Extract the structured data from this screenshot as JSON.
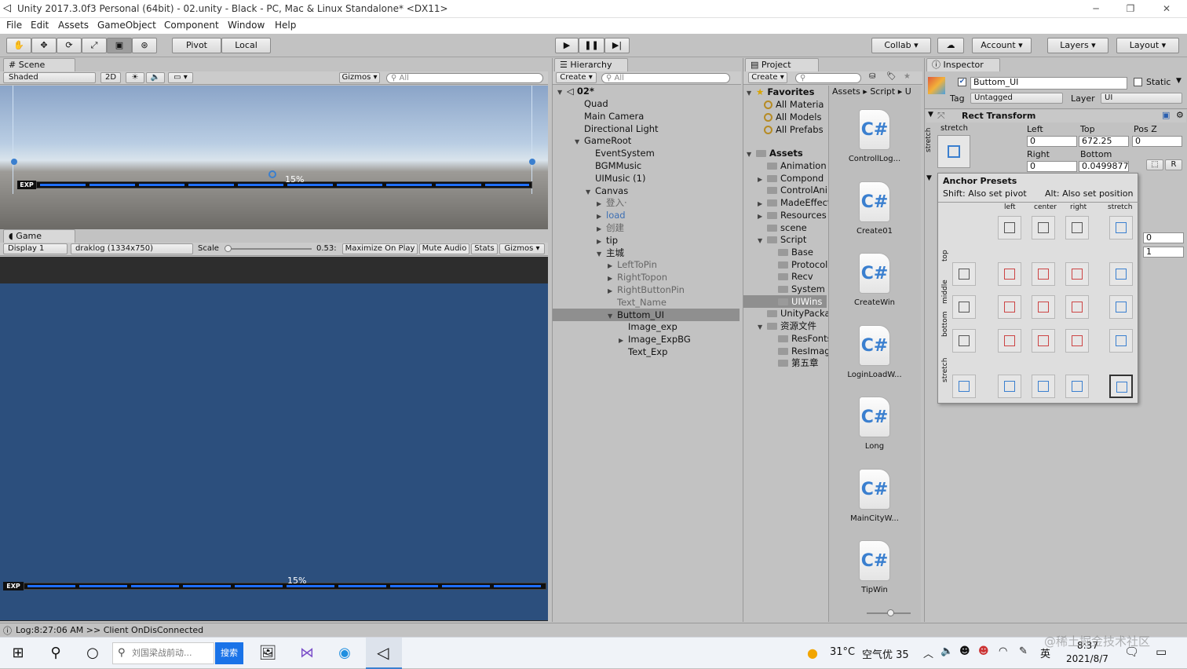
{
  "window": {
    "title": "Unity 2017.3.0f3 Personal (64bit) - 02.unity - Black - PC, Mac & Linux Standalone* <DX11>",
    "minimize": "─",
    "maximize": "❐",
    "close": "✕"
  },
  "menu": [
    "File",
    "Edit",
    "Assets",
    "GameObject",
    "Component",
    "Window",
    "Help"
  ],
  "toolbar": {
    "tools": [
      "hand-icon",
      "move-icon",
      "rotate-icon",
      "scale-icon",
      "rect-icon",
      "transform-icon"
    ],
    "pivot": "Pivot",
    "local": "Local",
    "collab": "Collab ▾",
    "account": "Account",
    "layers": "Layers",
    "layout": "Layout"
  },
  "scene": {
    "tab": "Scene",
    "shading": "Shaded",
    "mode2d": "2D",
    "gizmos": "Gizmos",
    "search_placeholder": "All",
    "exp_label": "EXP",
    "exp_percent": "15%"
  },
  "game": {
    "tab": "Game",
    "display": "Display 1",
    "resolution": "draklog (1334x750)",
    "scale_label": "Scale",
    "scale_value": "0.53:",
    "maximize": "Maximize On Play",
    "mute": "Mute Audio",
    "stats": "Stats",
    "gizmos": "Gizmos",
    "exp_label": "EXP",
    "exp_percent": "15%"
  },
  "hierarchy": {
    "tab": "Hierarchy",
    "create": "Create",
    "search_placeholder": "All",
    "scene_name": "02*",
    "items": [
      {
        "label": "Quad",
        "indent": 1,
        "arrow": ""
      },
      {
        "label": "Main Camera",
        "indent": 1,
        "arrow": ""
      },
      {
        "label": "Directional Light",
        "indent": 1,
        "arrow": ""
      },
      {
        "label": "GameRoot",
        "indent": 1,
        "arrow": "▼"
      },
      {
        "label": "EventSystem",
        "indent": 2,
        "arrow": ""
      },
      {
        "label": "BGMMusic",
        "indent": 2,
        "arrow": ""
      },
      {
        "label": "UIMusic (1)",
        "indent": 2,
        "arrow": ""
      },
      {
        "label": "Canvas",
        "indent": 2,
        "arrow": "▼"
      },
      {
        "label": "登入·",
        "indent": 3,
        "arrow": "▶",
        "dim": true
      },
      {
        "label": "load",
        "indent": 3,
        "arrow": "▶",
        "blue": true
      },
      {
        "label": "创建",
        "indent": 3,
        "arrow": "▶",
        "dim": true
      },
      {
        "label": "tip",
        "indent": 3,
        "arrow": "▶"
      },
      {
        "label": "主城",
        "indent": 3,
        "arrow": "▼"
      },
      {
        "label": "LeftToPin",
        "indent": 4,
        "arrow": "▶",
        "dim": true
      },
      {
        "label": "RightTopon",
        "indent": 4,
        "arrow": "▶",
        "dim": true
      },
      {
        "label": "RightButtonPin",
        "indent": 4,
        "arrow": "▶",
        "dim": true
      },
      {
        "label": "Text_Name",
        "indent": 4,
        "arrow": "",
        "dim": true
      },
      {
        "label": "Buttom_UI",
        "indent": 4,
        "arrow": "▼",
        "sel": true
      },
      {
        "label": "Image_exp",
        "indent": 5,
        "arrow": ""
      },
      {
        "label": "Image_ExpBG",
        "indent": 5,
        "arrow": "▶"
      },
      {
        "label": "Text_Exp",
        "indent": 5,
        "arrow": ""
      }
    ]
  },
  "project": {
    "tab": "Project",
    "create": "Create",
    "breadcrumb": [
      "Assets",
      "Script",
      "U"
    ],
    "favorites_label": "Favorites",
    "favorites": [
      "All Materia",
      "All Models",
      "All Prefabs"
    ],
    "assets_label": "Assets",
    "folders": [
      {
        "label": "Animation",
        "indent": 1,
        "arrow": ""
      },
      {
        "label": "Compond",
        "indent": 1,
        "arrow": "▶"
      },
      {
        "label": "ControlAni",
        "indent": 1,
        "arrow": ""
      },
      {
        "label": "MadeEffect",
        "indent": 1,
        "arrow": "▶"
      },
      {
        "label": "Resources",
        "indent": 1,
        "arrow": "▶"
      },
      {
        "label": "scene",
        "indent": 1,
        "arrow": ""
      },
      {
        "label": "Script",
        "indent": 1,
        "arrow": "▼"
      },
      {
        "label": "Base",
        "indent": 2,
        "arrow": ""
      },
      {
        "label": "Protocol",
        "indent": 2,
        "arrow": ""
      },
      {
        "label": "Recv",
        "indent": 2,
        "arrow": ""
      },
      {
        "label": "System",
        "indent": 2,
        "arrow": ""
      },
      {
        "label": "UIWins",
        "indent": 2,
        "arrow": "",
        "sel": true
      },
      {
        "label": "UnityPacka",
        "indent": 1,
        "arrow": ""
      },
      {
        "label": "资源文件",
        "indent": 1,
        "arrow": "▼"
      },
      {
        "label": "ResFonts",
        "indent": 2,
        "arrow": ""
      },
      {
        "label": "ResImag",
        "indent": 2,
        "arrow": ""
      },
      {
        "label": "第五章",
        "indent": 2,
        "arrow": ""
      }
    ],
    "files": [
      "ControllLog...",
      "Create01",
      "CreateWin",
      "LoginLoadW...",
      "Long",
      "MainCityW...",
      "TipWin"
    ],
    "cs_glyph": "C#"
  },
  "inspector": {
    "tab": "Inspector",
    "object_name": "Buttom_UI",
    "static_label": "Static",
    "tag_label": "Tag",
    "tag_value": "Untagged",
    "layer_label": "Layer",
    "layer_value": "UI",
    "rect_transform": "Rect Transform",
    "stretch": "stretch",
    "left_label": "Left",
    "left_value": "0",
    "top_label": "Top",
    "top_value": "672.25",
    "posz_label": "Pos Z",
    "posz_value": "0",
    "right_label": "Right",
    "right_value": "0",
    "bottom_label": "Bottom",
    "bottom_value": "0.0499877",
    "r_button": "R",
    "anchor_presets": "Anchor Presets",
    "shift_hint": "Shift: Also set pivot",
    "alt_hint": "Alt: Also set position",
    "col_labels": [
      "left",
      "center",
      "right",
      "stretch"
    ],
    "row_labels": [
      "top",
      "middle",
      "bottom",
      "stretch"
    ],
    "side_values": [
      "0",
      "1"
    ]
  },
  "status": {
    "text": "Log:8:27:06 AM >> Client OnDisConnected"
  },
  "taskbar": {
    "search_placeholder": "刘国梁战前动...",
    "search_button": "搜索",
    "temperature": "31°C",
    "air": "空气优 35",
    "ime": "英",
    "time": "8:37",
    "date": "2021/8/7",
    "watermark": "@稀土掘金技术社区"
  },
  "colors": {
    "game_bg": "#2c4f7d",
    "exp_fill": "#1f6fff",
    "selected": "#8f8f8f"
  }
}
